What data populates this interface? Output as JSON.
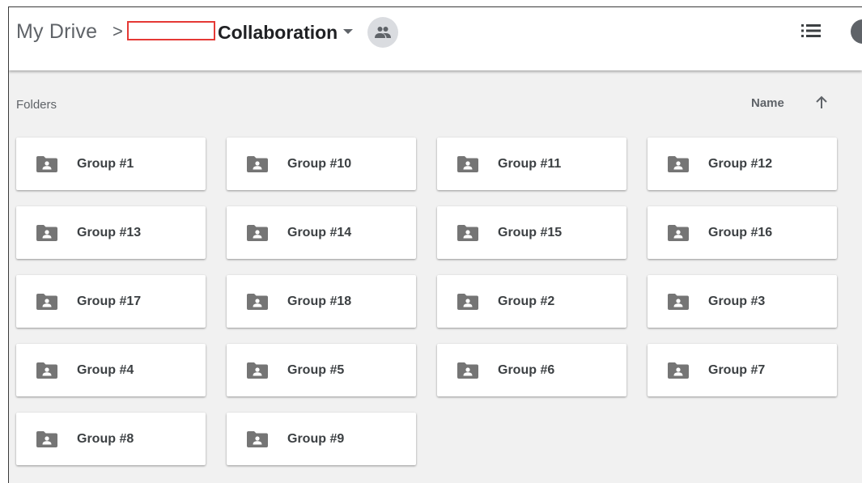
{
  "breadcrumb": {
    "root": "My Drive",
    "separator": ">",
    "current": "Collaboration"
  },
  "icons": {
    "dropdown": "caret-down-icon",
    "shared": "people-icon",
    "view_toggle": "list-view-icon",
    "sort_direction": "arrow-up-icon",
    "folder": "shared-folder-icon"
  },
  "colors": {
    "header_bg": "#ffffff",
    "content_bg": "#f1f1f1",
    "card_bg": "#ffffff",
    "icon_gray": "#5f6368",
    "highlight_box": "#e53935"
  },
  "folders_section": {
    "label": "Folders",
    "sort_label": "Name",
    "items": [
      {
        "name": "Group #1"
      },
      {
        "name": "Group #10"
      },
      {
        "name": "Group #11"
      },
      {
        "name": "Group #12"
      },
      {
        "name": "Group #13"
      },
      {
        "name": "Group #14"
      },
      {
        "name": "Group #15"
      },
      {
        "name": "Group #16"
      },
      {
        "name": "Group #17"
      },
      {
        "name": "Group #18"
      },
      {
        "name": "Group #2"
      },
      {
        "name": "Group #3"
      },
      {
        "name": "Group #4"
      },
      {
        "name": "Group #5"
      },
      {
        "name": "Group #6"
      },
      {
        "name": "Group #7"
      },
      {
        "name": "Group #8"
      },
      {
        "name": "Group #9"
      }
    ]
  }
}
